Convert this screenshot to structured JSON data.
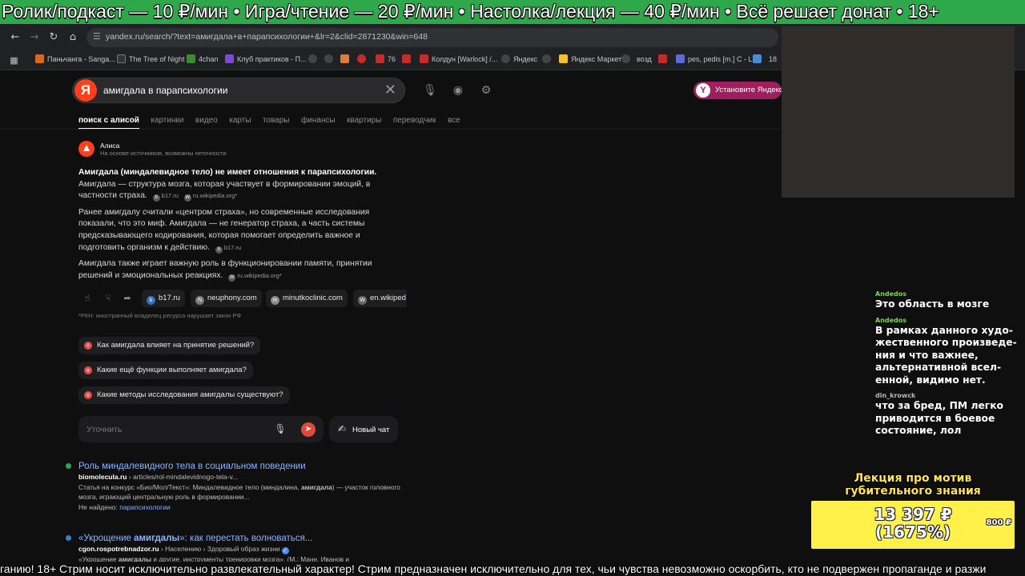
{
  "ticker_top": "Ролик/подкаст — 10 ₽/мин • Игра/чтение — 20 ₽/мин • Настолка/лекция — 40 ₽/мин • Всё решает донат • 18+",
  "browser": {
    "url": "yandex.ru/search/?text=амигдала+в+парапсихологии+&lr=2&clid=2871230&win=648",
    "nav_icons": [
      "back-icon",
      "forward-icon",
      "reload-icon",
      "home-icon",
      "site-settings-icon"
    ],
    "bookmarks": [
      {
        "label": "Паньчанга - Sanga...",
        "color": "#d26b1f"
      },
      {
        "label": "The Tree of Night",
        "color": "#333333"
      },
      {
        "label": "4chan",
        "color": "#3c8a2e"
      },
      {
        "label": "Клуб практиков - П...",
        "color": "#7b4bd1"
      },
      {
        "label": "",
        "color": "#444444"
      },
      {
        "label": "",
        "color": "#444444"
      },
      {
        "label": "",
        "color": "#e07a3a"
      },
      {
        "label": "",
        "color": "#c42b2b"
      },
      {
        "label": "76",
        "color": "#c42b2b"
      },
      {
        "label": "",
        "color": "#c42b2b"
      },
      {
        "label": "Колдун [Warlock] /...",
        "color": "#c42b2b"
      },
      {
        "label": "Яндекс",
        "color": "#444444"
      },
      {
        "label": "",
        "color": "#444444"
      },
      {
        "label": "Яндекс Маркет",
        "color": "#f2c12e"
      },
      {
        "label": "",
        "color": "#444444"
      },
      {
        "label": "возд",
        "color": "#444444"
      },
      {
        "label": "",
        "color": "#c42b2b"
      },
      {
        "label": "pes, pedis [m.] C - L...",
        "color": "#5b6bd1"
      },
      {
        "label": "",
        "color": "#4a8bd1"
      },
      {
        "label": "",
        "color": "#3c7a3c"
      },
      {
        "label": "18",
        "color": "#c42b2b"
      }
    ]
  },
  "search": {
    "logo": "Я",
    "query": "амигдала в парапсихологии",
    "install_label": "Установите Яндекс",
    "tabs": [
      {
        "label": "поиск с алисой",
        "active": true
      },
      {
        "label": "картинки",
        "active": false
      },
      {
        "label": "видео",
        "active": false
      },
      {
        "label": "карты",
        "active": false
      },
      {
        "label": "товары",
        "active": false
      },
      {
        "label": "финансы",
        "active": false
      },
      {
        "label": "квартиры",
        "active": false
      },
      {
        "label": "переводчик",
        "active": false
      },
      {
        "label": "все",
        "active": false
      }
    ]
  },
  "alice": {
    "name": "Алиса",
    "disclaimer": "На основе источников, возможны неточности",
    "p1_lead": "Амигдала (миндалевидное тело) не имеет отношения к парапсихологии.",
    "p1_text": "Амигдала — структура мозга, которая участвует в формировании эмоций, в частности страха.",
    "p1_src1": "b17.ru",
    "p1_src2": "ru.wikipedia.org*",
    "p2_text": "Ранее амигдалу считали «центром страха», но современные исследования показали, что это миф. Амигдала — не генератор страха, а часть системы предсказывающего кодирования, которая помогает определить важное и подготовить организм к действию.",
    "p2_src": "b17.ru",
    "p3_text": "Амигдала также играет важную роль в функционировании памяти, принятии решений и эмоциональных реакциях.",
    "p3_src": "ru.wikipedia.org*",
    "source_chips": [
      "b17.ru",
      "neuphony.com",
      "minutkoclinic.com",
      "en.wikiped"
    ],
    "rkn": "*РКН: иностранный владелец ресурса нарушает закон РФ",
    "suggestions": [
      "Как амигдала влияет на принятие решений?",
      "Какие ещё функции выполняет амигдала?",
      "Какие методы исследования амигдалы существуют?"
    ],
    "refine_placeholder": "Уточнить",
    "new_chat": "Новый чат"
  },
  "results": [
    {
      "title": "Роль миндалевидного тела в социальном поведении",
      "domain": "biomolecula.ru",
      "path": " › articles/rol-mindalevidnogo-tela-v...",
      "desc_a": "Статья на конкурс «Био/Мол/Текст»: Миндалевидное тело (миндалина, ",
      "desc_bold": "амигдала",
      "desc_b": ") — участок головного мозга, играющий центральную роль в формировании...",
      "missing_label": "Не найдено: ",
      "missing_word": "парапсихологии"
    },
    {
      "title_a": "«Укрощение ",
      "title_bold": "амигдалы",
      "title_b": "»: как перестать волноваться...",
      "domain": "cgon.rospotrebnadzor.ru",
      "path": " › Населению › Здоровый образ жизни",
      "desc_a": "«Укрощение ",
      "desc_bold": "амигдалы",
      "desc_b": " и другие. инструменты тренировки мозга». (М.: Манн, Иванов и"
    }
  ],
  "chat": [
    {
      "nick": "Andedos",
      "nick_color": "#7cd84a",
      "text": "Это область в мозге"
    },
    {
      "nick": "Andedos",
      "nick_color": "#7cd84a",
      "text": "В рамках данного худо­жественного произведе­ния и что важнее, альтернативной всел­енной, видимо нет."
    },
    {
      "nick": "din_krowck",
      "nick_color": "#b7b7b7",
      "text": "что за бред, ПМ легко приводится в боевое состояние, лол"
    }
  ],
  "goal": {
    "title": "Лекция про мотив губительного знания",
    "amount": "13 397 ₽",
    "percent": "(1675%)",
    "target": "800 ₽"
  },
  "ticker_bottom": "ганию! 18+ Стрим носит исключительно развлекательный характер! Стрим предназначен исключительно для тех, чьи чувства невозможно оскорбить, кто не подвержен пропаганде и разжи"
}
